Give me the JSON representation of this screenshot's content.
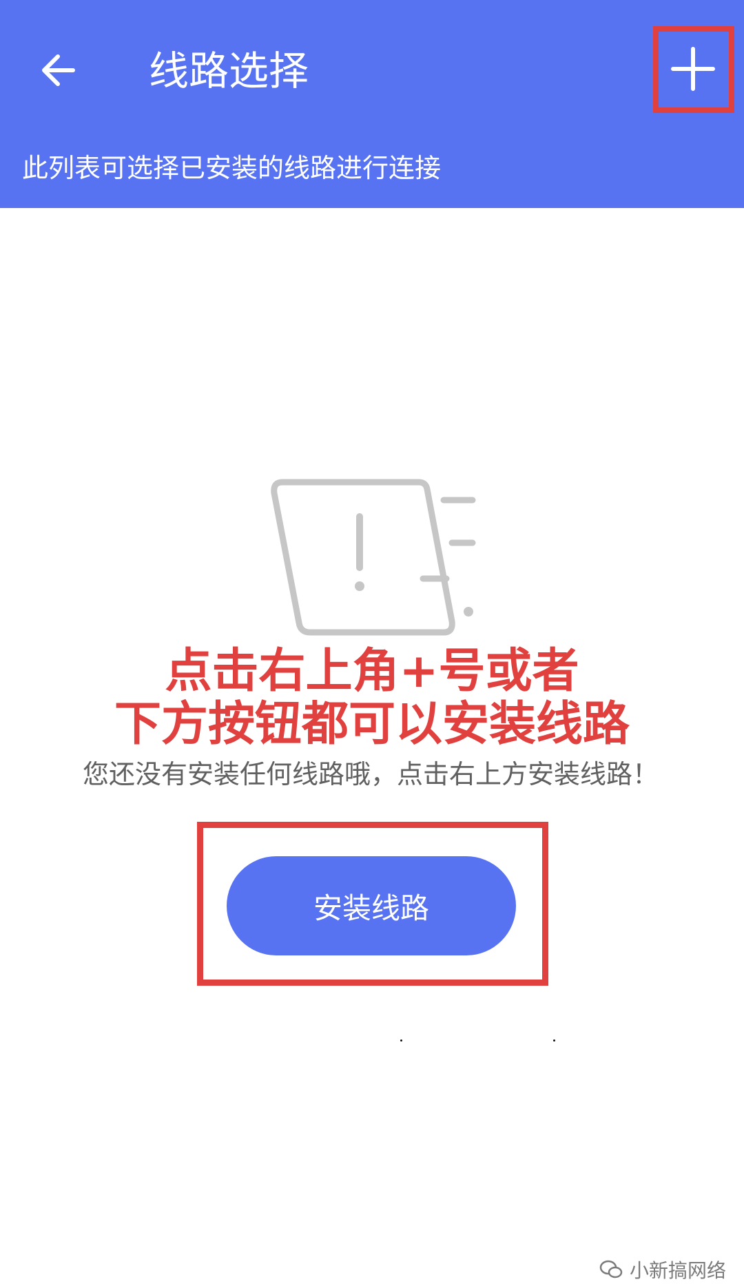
{
  "header": {
    "title": "线路选择",
    "subtitle": "此列表可选择已安装的线路进行连接",
    "back_icon": "arrow-left-icon",
    "add_icon": "plus-icon"
  },
  "annotation": {
    "line1": "点击右上角+号或者",
    "line2": "下方按钮都可以安装线路"
  },
  "empty_state": {
    "message": "您还没有安装任何线路哦，点击右上方安装线路！",
    "icon": "empty-warning-icon"
  },
  "install_button": {
    "label": "安装线路"
  },
  "watermark": {
    "text": "小新搞网络"
  },
  "colors": {
    "primary": "#5773f1",
    "annotation": "#e0413f",
    "illustration": "#c6c6c6"
  }
}
